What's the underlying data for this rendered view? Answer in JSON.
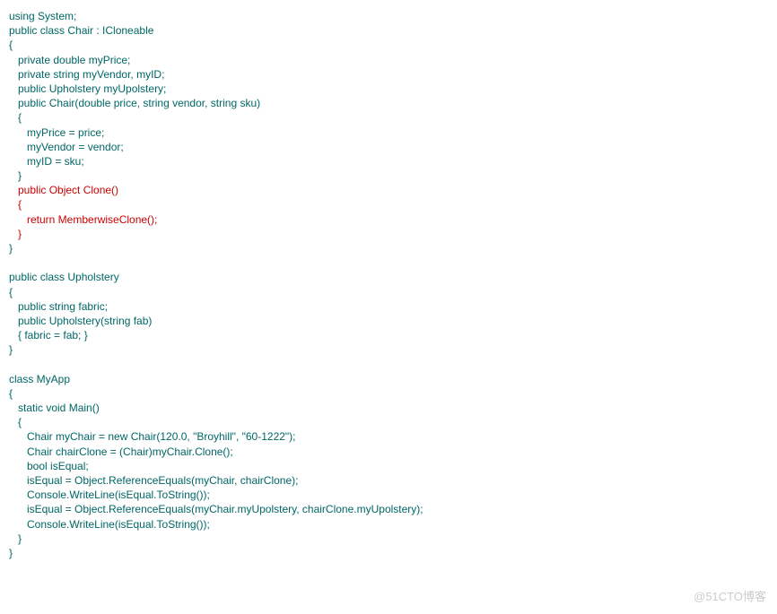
{
  "code": {
    "l01": "using System;",
    "l02": "public class Chair : ICloneable",
    "l03": "{",
    "l04": "   private double myPrice;",
    "l05": "   private string myVendor, myID;",
    "l06": "   public Upholstery myUpolstery;",
    "l07": "   public Chair(double price, string vendor, string sku)",
    "l08": "   {",
    "l09": "      myPrice = price;",
    "l10": "      myVendor = vendor;",
    "l11": "      myID = sku;",
    "l12": "   }",
    "l13": "   public Object Clone()",
    "l14": "   {",
    "l15": "      return MemberwiseClone();",
    "l16": "   }",
    "l17": "}",
    "l18": "",
    "l19": "public class Upholstery",
    "l20": "{",
    "l21": "   public string fabric;",
    "l22": "   public Upholstery(string fab)",
    "l23": "   { fabric = fab; }",
    "l24": "}",
    "l25": "",
    "l26": "class MyApp",
    "l27": "{",
    "l28": "   static void Main()",
    "l29": "   {",
    "l30": "      Chair myChair = new Chair(120.0, \"Broyhill\", \"60-1222\");",
    "l31": "      Chair chairClone = (Chair)myChair.Clone();",
    "l32": "      bool isEqual;",
    "l33": "      isEqual = Object.ReferenceEquals(myChair, chairClone);",
    "l34": "      Console.WriteLine(isEqual.ToString());",
    "l35": "      isEqual = Object.ReferenceEquals(myChair.myUpolstery, chairClone.myUpolstery);",
    "l36": "      Console.WriteLine(isEqual.ToString());",
    "l37": "   }",
    "l38": "}"
  },
  "watermark": "@51CTO博客"
}
